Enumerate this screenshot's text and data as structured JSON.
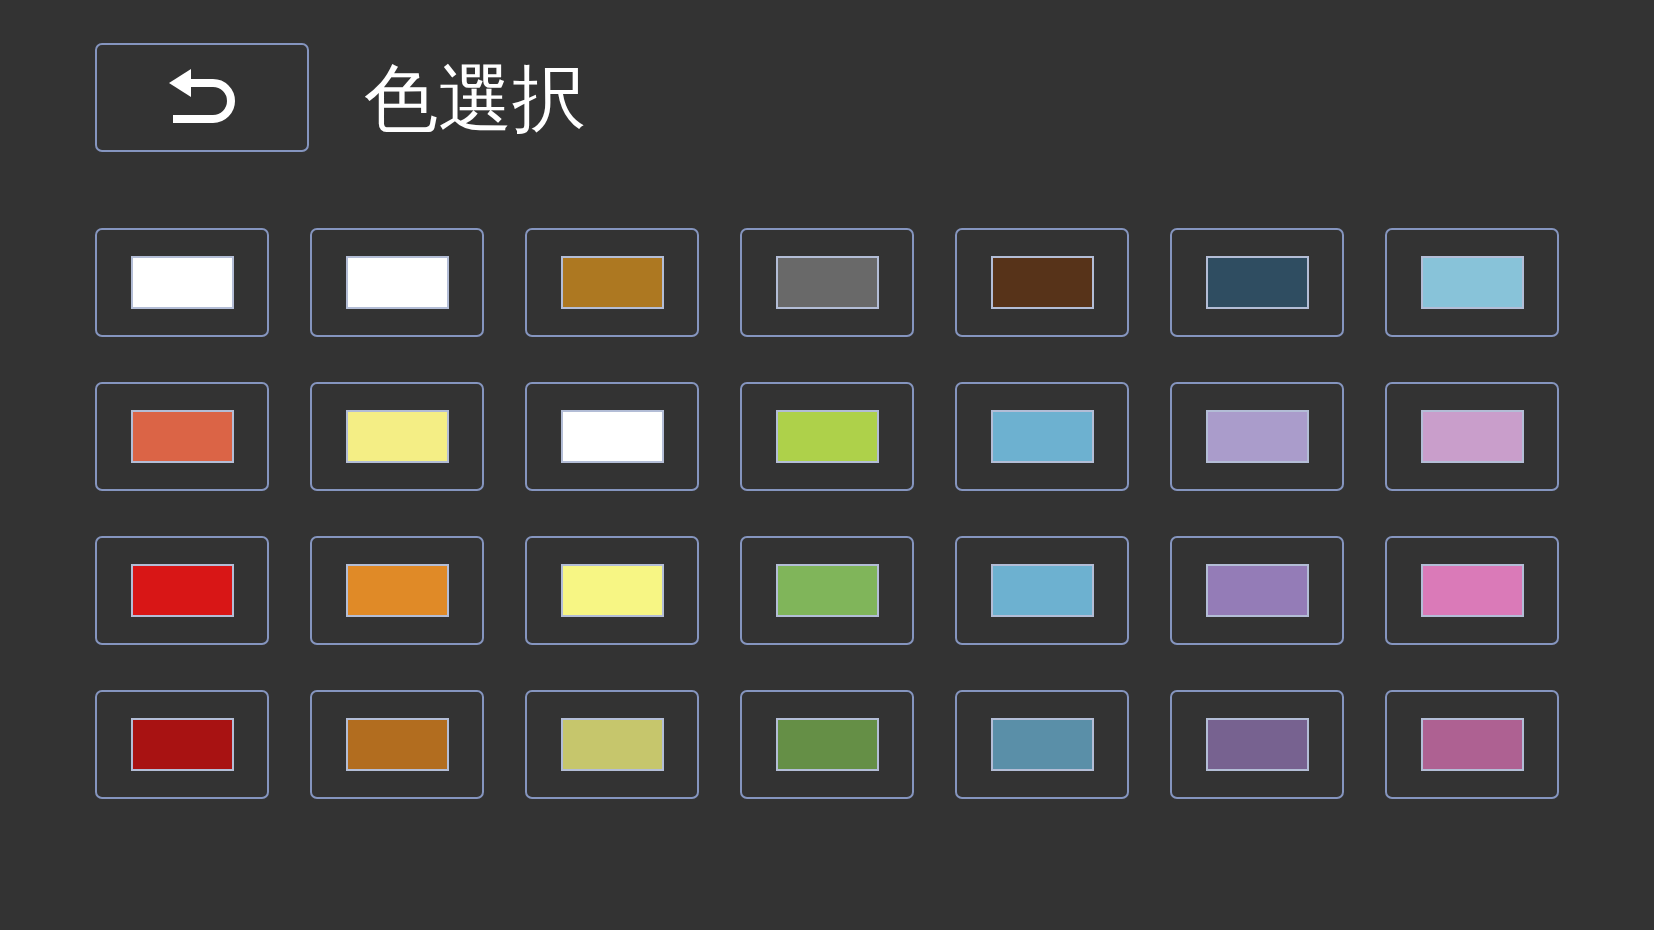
{
  "header": {
    "title": "色選択"
  },
  "swatches": [
    {
      "color": "#ffffff"
    },
    {
      "color": "#ffffff"
    },
    {
      "color": "#ad7821"
    },
    {
      "color": "#696969"
    },
    {
      "color": "#573319"
    },
    {
      "color": "#2f4d61"
    },
    {
      "color": "#88c3d9"
    },
    {
      "color": "#db6446"
    },
    {
      "color": "#f4ee85"
    },
    {
      "color": "#ffffff"
    },
    {
      "color": "#aed14a"
    },
    {
      "color": "#6db1d0"
    },
    {
      "color": "#aa9ccb"
    },
    {
      "color": "#c99ecb"
    },
    {
      "color": "#d81616"
    },
    {
      "color": "#e08a27"
    },
    {
      "color": "#f7f684"
    },
    {
      "color": "#80b55a"
    },
    {
      "color": "#6db1d0"
    },
    {
      "color": "#947cb7"
    },
    {
      "color": "#da7ab8"
    },
    {
      "color": "#a81212"
    },
    {
      "color": "#b26d1f"
    },
    {
      "color": "#c6c66c"
    },
    {
      "color": "#658f46"
    },
    {
      "color": "#5a8fa8"
    },
    {
      "color": "#776290"
    },
    {
      "color": "#ae6192"
    }
  ]
}
